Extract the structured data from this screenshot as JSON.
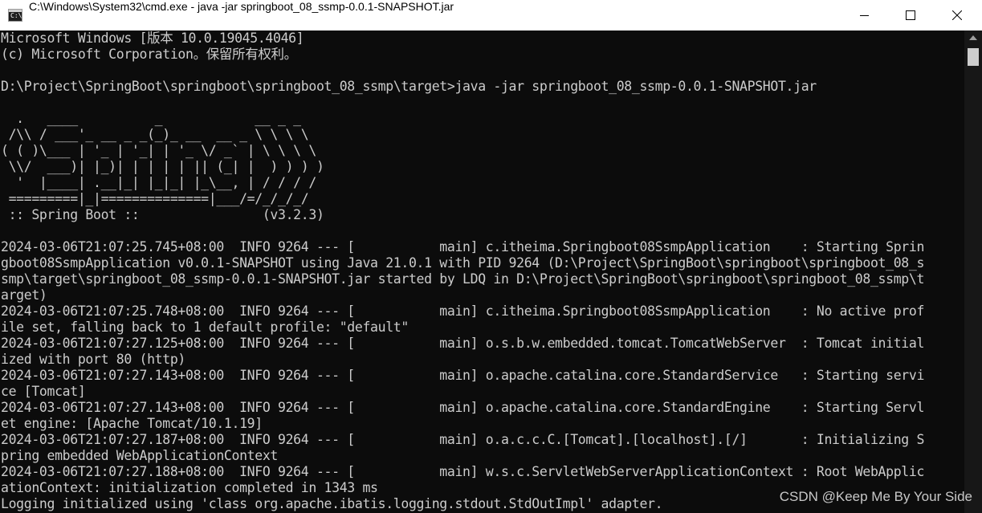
{
  "window": {
    "title": "C:\\Windows\\System32\\cmd.exe - java  -jar springboot_08_ssmp-0.0.1-SNAPSHOT.jar",
    "app_icon_text": "C:\\.",
    "controls": {
      "minimize": "minimize-icon",
      "maximize": "maximize-icon",
      "close": "close-icon"
    }
  },
  "console": {
    "lines": [
      "Microsoft Windows [版本 10.0.19045.4046]",
      "(c) Microsoft Corporation。保留所有权利。",
      "",
      "D:\\Project\\SpringBoot\\springboot\\springboot_08_ssmp\\target>java -jar springboot_08_ssmp-0.0.1-SNAPSHOT.jar",
      "",
      "  .   ____          _            __ _ _",
      " /\\\\ / ___'_ __ _ _(_)_ __  __ _ \\ \\ \\ \\",
      "( ( )\\___ | '_ | '_| | '_ \\/ _` | \\ \\ \\ \\",
      " \\\\/  ___)| |_)| | | | | || (_| |  ) ) ) )",
      "  '  |____| .__|_| |_|_| |_\\__, | / / / /",
      " =========|_|==============|___/=/_/_/_/",
      " :: Spring Boot ::                (v3.2.3)",
      "",
      "2024-03-06T21:07:25.745+08:00  INFO 9264 --- [           main] c.itheima.Springboot08SsmpApplication    : Starting Sprin",
      "gboot08SsmpApplication v0.0.1-SNAPSHOT using Java 21.0.1 with PID 9264 (D:\\Project\\SpringBoot\\springboot\\springboot_08_s",
      "smp\\target\\springboot_08_ssmp-0.0.1-SNAPSHOT.jar started by LDQ in D:\\Project\\SpringBoot\\springboot\\springboot_08_ssmp\\t",
      "arget)",
      "2024-03-06T21:07:25.748+08:00  INFO 9264 --- [           main] c.itheima.Springboot08SsmpApplication    : No active prof",
      "ile set, falling back to 1 default profile: \"default\"",
      "2024-03-06T21:07:27.125+08:00  INFO 9264 --- [           main] o.s.b.w.embedded.tomcat.TomcatWebServer  : Tomcat initial",
      "ized with port 80 (http)",
      "2024-03-06T21:07:27.143+08:00  INFO 9264 --- [           main] o.apache.catalina.core.StandardService   : Starting servi",
      "ce [Tomcat]",
      "2024-03-06T21:07:27.143+08:00  INFO 9264 --- [           main] o.apache.catalina.core.StandardEngine    : Starting Servl",
      "et engine: [Apache Tomcat/10.1.19]",
      "2024-03-06T21:07:27.187+08:00  INFO 9264 --- [           main] o.a.c.c.C.[Tomcat].[localhost].[/]       : Initializing S",
      "pring embedded WebApplicationContext",
      "2024-03-06T21:07:27.188+08:00  INFO 9264 --- [           main] w.s.c.ServletWebServerApplicationContext : Root WebApplic",
      "ationContext: initialization completed in 1343 ms",
      "Logging initialized using 'class org.apache.ibatis.logging.stdout.StdOutImpl' adapter."
    ]
  },
  "watermark": "CSDN @Keep Me By Your Side",
  "colors": {
    "console_bg": "#0c0c0c",
    "console_text": "#cccccc",
    "titlebar_bg": "#ffffff"
  }
}
